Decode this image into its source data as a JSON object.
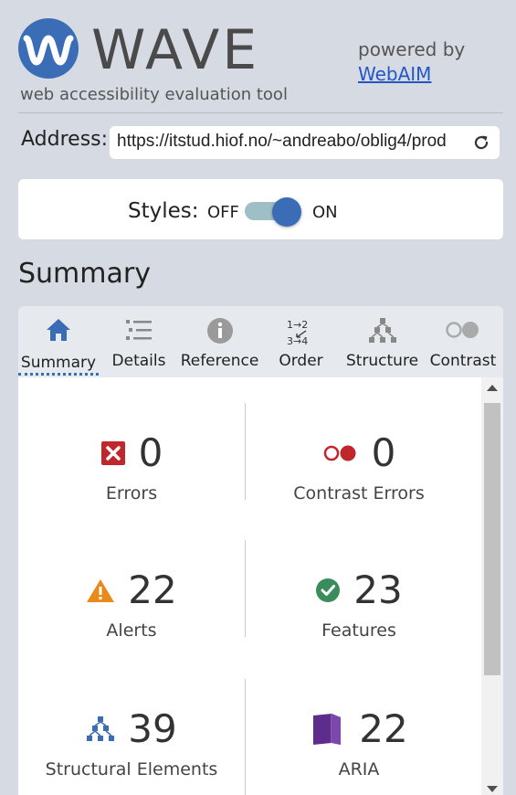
{
  "header": {
    "logo_text": "WAVE",
    "tagline": "web accessibility evaluation tool",
    "powered_by": "powered by",
    "webaim_link": "WebAIM"
  },
  "address": {
    "label": "Address:",
    "value": "https://itstud.hiof.no/~andreabo/oblig4/prod"
  },
  "styles": {
    "label": "Styles:",
    "off": "OFF",
    "on": "ON",
    "enabled": true
  },
  "summary_heading": "Summary",
  "tabs": [
    {
      "label": "Summary",
      "icon": "home-icon",
      "active": true
    },
    {
      "label": "Details",
      "icon": "list-icon",
      "active": false
    },
    {
      "label": "Reference",
      "icon": "info-icon",
      "active": false
    },
    {
      "label": "Order",
      "icon": "order-icon",
      "active": false
    },
    {
      "label": "Structure",
      "icon": "structure-icon",
      "active": false
    },
    {
      "label": "Contrast",
      "icon": "contrast-icon",
      "active": false
    }
  ],
  "stats": {
    "errors": {
      "count": "0",
      "label": "Errors"
    },
    "contrast_errors": {
      "count": "0",
      "label": "Contrast Errors"
    },
    "alerts": {
      "count": "22",
      "label": "Alerts"
    },
    "features": {
      "count": "23",
      "label": "Features"
    },
    "structural": {
      "count": "39",
      "label": "Structural Elements"
    },
    "aria": {
      "count": "22",
      "label": "ARIA"
    }
  },
  "colors": {
    "brand_blue": "#3a6db5",
    "error_red": "#c0272d",
    "alert_orange": "#e98b1a",
    "feature_green": "#3a8c5c",
    "aria_purple": "#5e2c8a"
  }
}
